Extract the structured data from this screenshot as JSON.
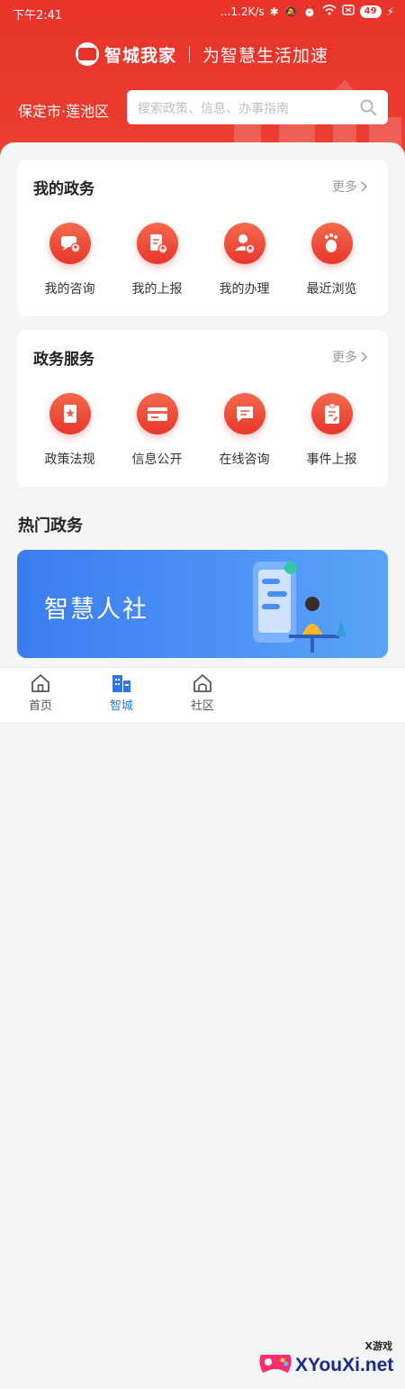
{
  "status_bar": {
    "time": "下午2:41",
    "network_speed": "...1.2K/s",
    "battery": "49"
  },
  "brand": {
    "name": "智城我家",
    "slogan": "为智慧生活加速"
  },
  "location": "保定市·莲池区",
  "search": {
    "placeholder": "搜索政策、信息、办事指南"
  },
  "my_affairs": {
    "title": "我的政务",
    "more": "更多",
    "items": [
      {
        "label": "我的咨询",
        "icon": "consult-user-icon"
      },
      {
        "label": "我的上报",
        "icon": "report-user-icon"
      },
      {
        "label": "我的办理",
        "icon": "handle-user-icon"
      },
      {
        "label": "最近浏览",
        "icon": "footprint-icon"
      }
    ]
  },
  "gov_services": {
    "title": "政务服务",
    "more": "更多",
    "items": [
      {
        "label": "政策法规",
        "icon": "policy-doc-icon"
      },
      {
        "label": "信息公开",
        "icon": "info-card-icon"
      },
      {
        "label": "在线咨询",
        "icon": "chat-icon"
      },
      {
        "label": "事件上报",
        "icon": "clipboard-edit-icon"
      }
    ]
  },
  "hot_section": {
    "title": "热门政务"
  },
  "banner": {
    "title": "智慧人社"
  },
  "tabbar": {
    "tabs": [
      {
        "label": "首页"
      },
      {
        "label": "智城"
      },
      {
        "label": "社区"
      }
    ],
    "active": "智城"
  },
  "watermark": {
    "small": "X游戏",
    "text": "XYouXi.net"
  },
  "colors": {
    "primary_red": "#e8332a",
    "active_blue": "#2a78ea",
    "banner_blue": "#3a7cf0"
  }
}
